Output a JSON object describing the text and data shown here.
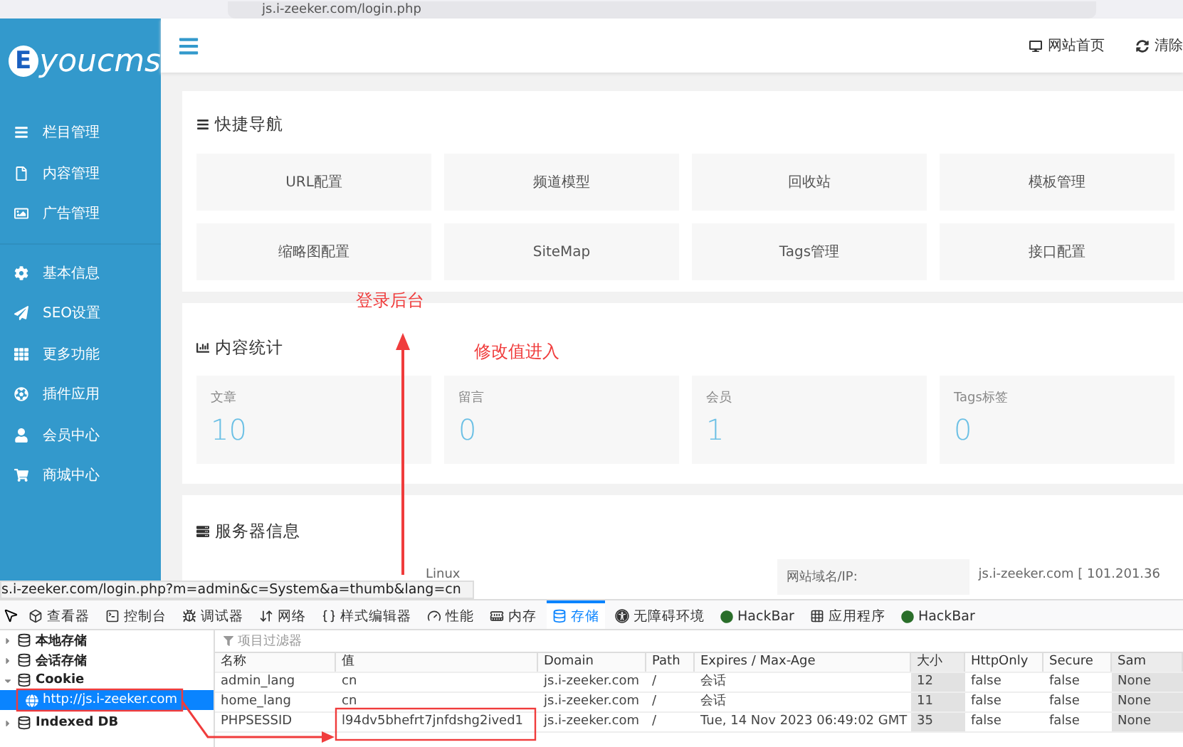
{
  "browser": {
    "url": "js.i-zeeker.com/login.php"
  },
  "sidebar": {
    "logo_letter": "E",
    "logo_text": "youcms",
    "groups": [
      [
        {
          "label": "栏目管理"
        },
        {
          "label": "内容管理"
        },
        {
          "label": "广告管理"
        }
      ],
      [
        {
          "label": "基本信息"
        },
        {
          "label": "SEO设置"
        },
        {
          "label": "更多功能"
        },
        {
          "label": "插件应用"
        },
        {
          "label": "会员中心"
        },
        {
          "label": "商城中心"
        }
      ]
    ]
  },
  "header": {
    "links": [
      {
        "label": "网站首页"
      },
      {
        "label": "清除"
      }
    ]
  },
  "quick_nav": {
    "title": "快捷导航",
    "tiles": [
      "URL配置",
      "频道模型",
      "回收站",
      "模板管理",
      "缩略图配置",
      "SiteMap",
      "Tags管理",
      "接口配置"
    ]
  },
  "stats": {
    "title": "内容统计",
    "items": [
      {
        "label": "文章",
        "value": "10"
      },
      {
        "label": "留言",
        "value": "0"
      },
      {
        "label": "会员",
        "value": "1"
      },
      {
        "label": "Tags标签",
        "value": "0"
      }
    ]
  },
  "server": {
    "title": "服务器信息",
    "os": "Linux",
    "domain_label": "网站域名/IP:",
    "domain_value": "js.i-zeeker.com [ 101.201.36"
  },
  "status_url": "s.i-zeeker.com/login.php?m=admin&c=System&a=thumb&lang=cn",
  "devtools": {
    "tabs": [
      {
        "label": "查看器",
        "selected": false
      },
      {
        "label": "控制台",
        "selected": false
      },
      {
        "label": "调试器",
        "selected": false
      },
      {
        "label": "网络",
        "selected": false
      },
      {
        "label": "样式编辑器",
        "selected": false
      },
      {
        "label": "性能",
        "selected": false
      },
      {
        "label": "内存",
        "selected": false
      },
      {
        "label": "存储",
        "selected": true
      },
      {
        "label": "无障碍环境",
        "selected": false
      },
      {
        "label": "HackBar",
        "selected": false
      },
      {
        "label": "应用程序",
        "selected": false
      },
      {
        "label": "HackBar",
        "selected": false
      }
    ],
    "tree": [
      {
        "label": "本地存储",
        "expanded": false,
        "selected": false
      },
      {
        "label": "会话存储",
        "expanded": false,
        "selected": false
      },
      {
        "label": "Cookie",
        "expanded": true,
        "selected": false,
        "children": [
          {
            "label": "http://js.i-zeeker.com",
            "selected": true
          }
        ]
      },
      {
        "label": "Indexed DB",
        "expanded": false,
        "selected": false
      }
    ],
    "filter_placeholder": "项目过滤器",
    "columns": [
      "名称",
      "值",
      "Domain",
      "Path",
      "Expires / Max-Age",
      "大小",
      "HttpOnly",
      "Secure",
      "Sam"
    ],
    "rows": [
      [
        "admin_lang",
        "cn",
        "js.i-zeeker.com",
        "/",
        "会话",
        "12",
        "false",
        "false",
        "None"
      ],
      [
        "home_lang",
        "cn",
        "js.i-zeeker.com",
        "/",
        "会话",
        "11",
        "false",
        "false",
        "None"
      ],
      [
        "PHPSESSID",
        "l94dv5bhefrt7jnfdshg2ived1",
        "js.i-zeeker.com",
        "/",
        "Tue, 14 Nov 2023 06:49:02 GMT",
        "35",
        "false",
        "false",
        "None"
      ]
    ]
  },
  "annotations": {
    "labels": [
      "登录后台",
      "修改值进入"
    ]
  }
}
